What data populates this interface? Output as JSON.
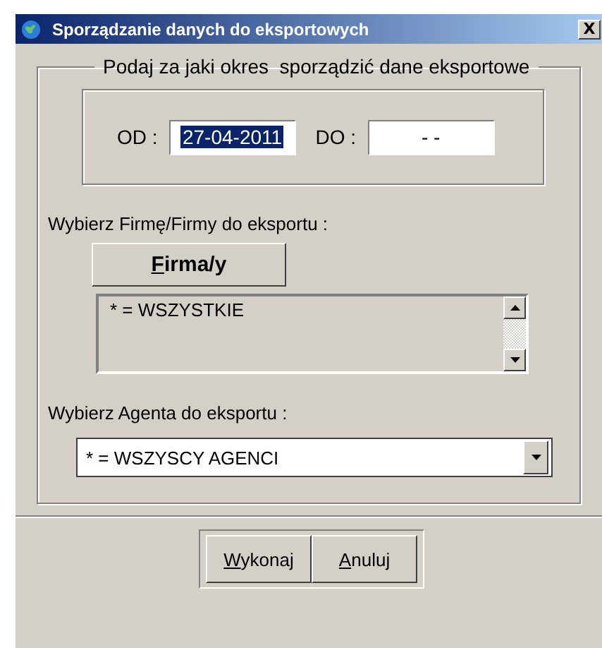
{
  "window": {
    "title": "Sporządzanie danych do eksportowych",
    "close": "X"
  },
  "period_group": {
    "legend": "Podaj za jaki okres  sporządzić dane eksportowe",
    "fields": [
      {
        "label": "OD :",
        "value": "27-04-2011",
        "selected": true
      },
      {
        "label": "DO :",
        "value": "- -",
        "selected": false
      }
    ]
  },
  "firms": {
    "label": "Wybierz Firmę/Firmy do eksportu :",
    "button": {
      "label": "Firma/y"
    },
    "list": [
      "* = WSZYSTKIE"
    ]
  },
  "agent": {
    "label": "Wybierz Agenta do eksportu :",
    "value": "* = WSZYSCY AGENCI"
  },
  "buttons": [
    {
      "label": "Wykonaj"
    },
    {
      "label": "Anuluj"
    }
  ]
}
